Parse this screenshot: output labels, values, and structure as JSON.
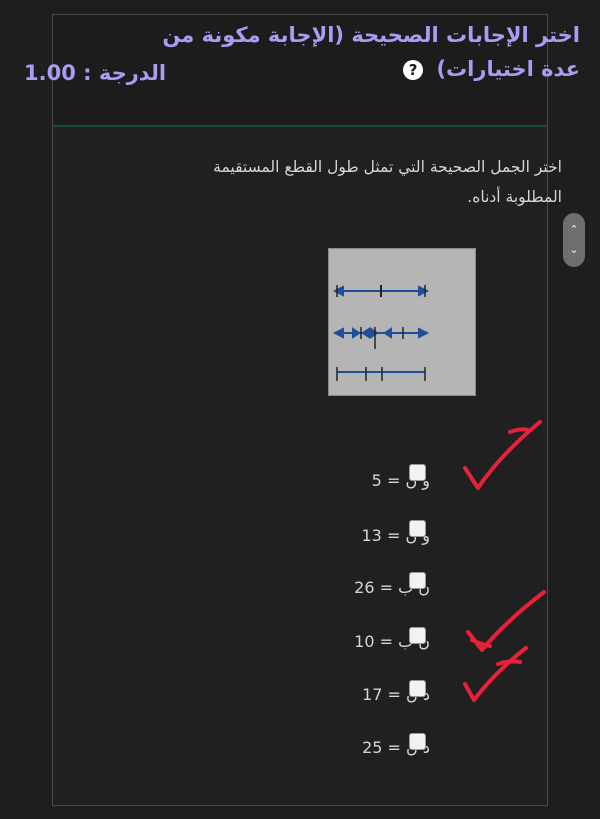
{
  "question": {
    "title": "اختر الإجابات الصحيحة (الإجابة مكونة من عدة اختيارات)",
    "help_icon": "question-circle-icon",
    "grade": "الدرجة : 1.00",
    "prompt": "اختر الجمل الصحيحة التي تمثل طول القطع المستقيمة المطلوبة أدناه."
  },
  "options": [
    {
      "label": "و ن = 5"
    },
    {
      "label": "و ن = 13"
    },
    {
      "label": "ن ب = 26"
    },
    {
      "label": "ن ب = 10"
    },
    {
      "label": "د ن = 17"
    },
    {
      "label": "د ن = 25"
    }
  ],
  "annotations": {
    "pen_color": "#e8213a",
    "checkmarks_on_options": [
      0,
      3,
      4
    ]
  },
  "scroll_handle": {
    "up_icon": "chevron-up-icon",
    "down_icon": "chevron-down-icon"
  }
}
